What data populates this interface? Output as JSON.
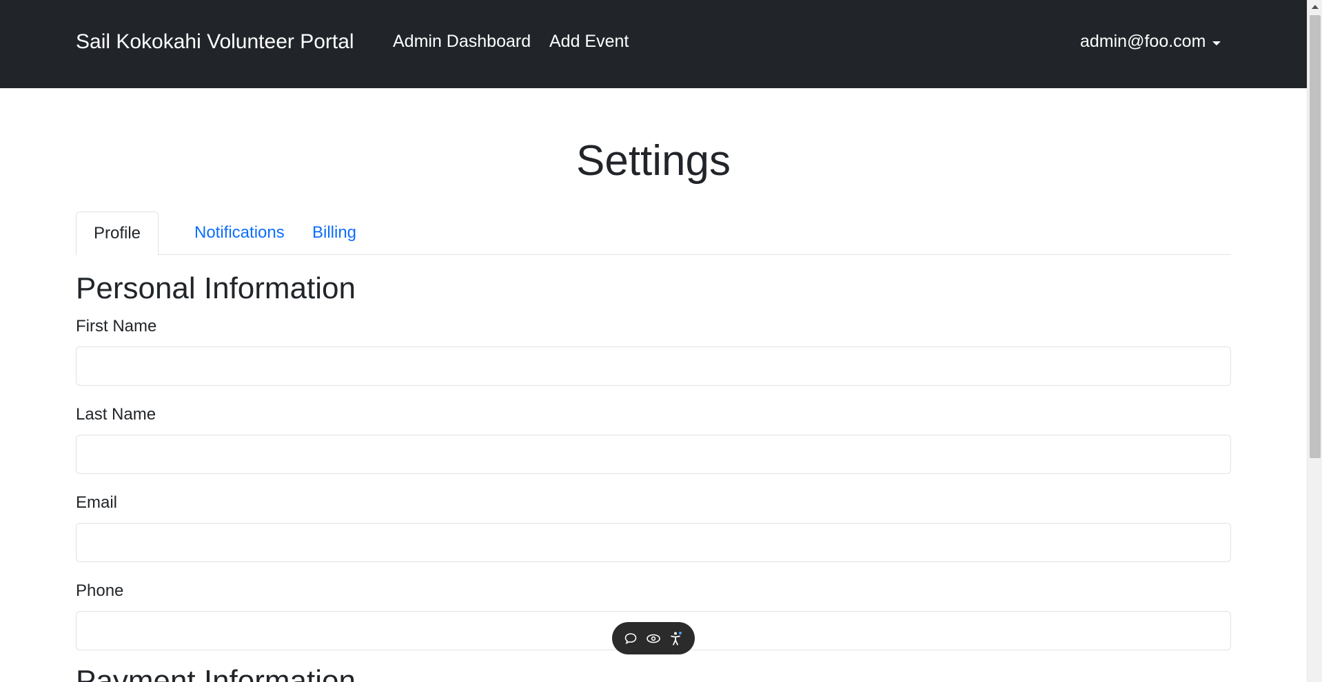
{
  "navbar": {
    "brand": "Sail Kokokahi Volunteer Portal",
    "links": [
      "Admin Dashboard",
      "Add Event"
    ],
    "user": "admin@foo.com"
  },
  "page": {
    "title": "Settings"
  },
  "tabs": [
    {
      "label": "Profile",
      "active": true
    },
    {
      "label": "Notifications",
      "active": false
    },
    {
      "label": "Billing",
      "active": false
    }
  ],
  "personal": {
    "title": "Personal Information",
    "fields": [
      {
        "label": "First Name",
        "value": "",
        "placeholder": ""
      },
      {
        "label": "Last Name",
        "value": "",
        "placeholder": ""
      },
      {
        "label": "Email",
        "value": "",
        "placeholder": ""
      },
      {
        "label": "Phone",
        "value": "",
        "placeholder": ""
      }
    ]
  },
  "payment": {
    "title": "Payment Information"
  },
  "toolbar": {
    "icons": [
      "chat-icon",
      "eye-icon",
      "accessibility-icon"
    ]
  },
  "colors": {
    "navbar_bg": "#212529",
    "link": "#0d6efd",
    "text": "#212529",
    "border": "#dee2e6"
  }
}
